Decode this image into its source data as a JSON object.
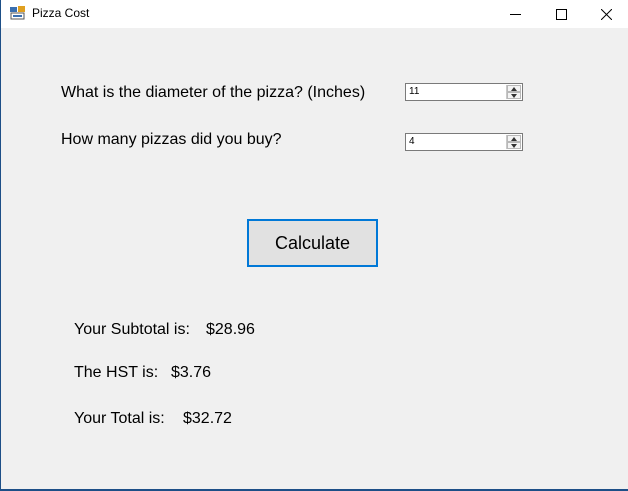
{
  "window": {
    "title": "Pizza Cost"
  },
  "form": {
    "diameter_label": "What is the diameter of the pizza? (Inches)",
    "diameter_value": "11",
    "count_label": "How many pizzas did you buy?",
    "count_value": "4",
    "calculate_label": "Calculate"
  },
  "results": {
    "subtotal_label": "Your Subtotal is:",
    "subtotal_value": "$28.96",
    "hst_label": "The HST is:",
    "hst_value": "$3.76",
    "total_label": "Your Total is:",
    "total_value": "$32.72"
  }
}
